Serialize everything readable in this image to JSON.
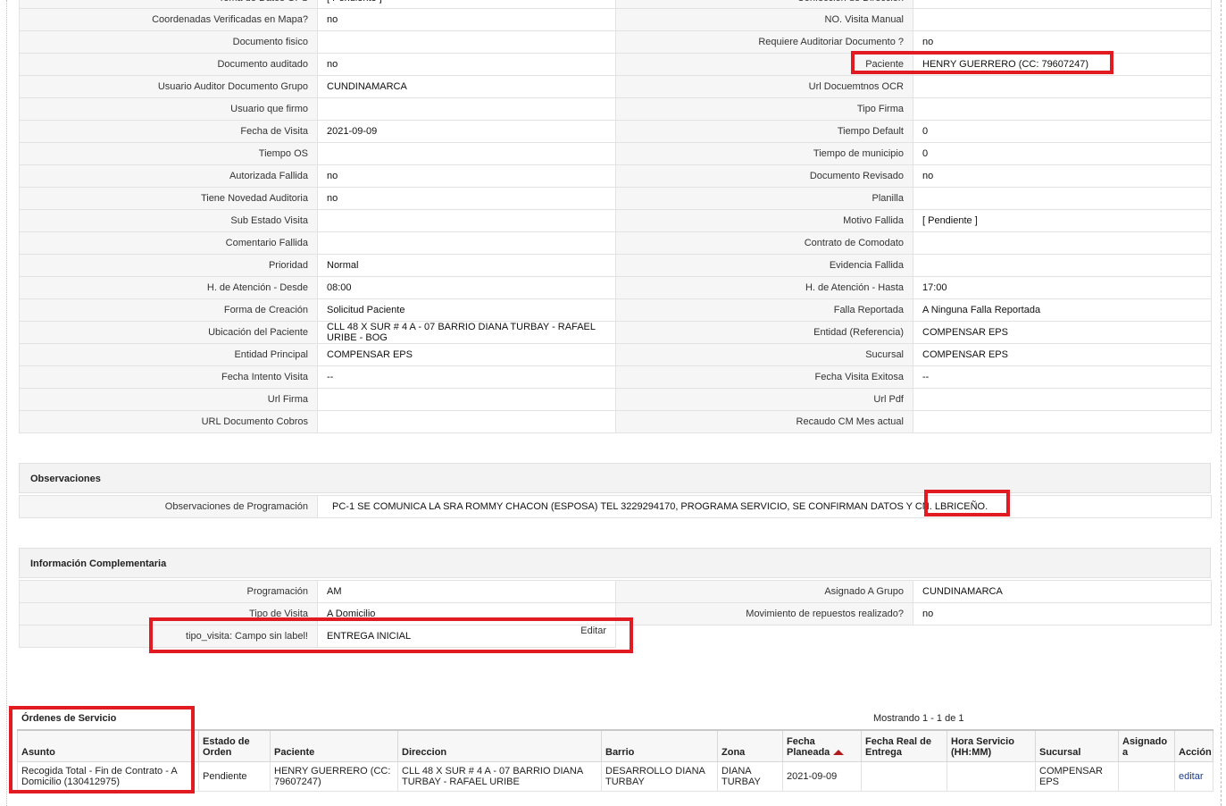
{
  "details": [
    [
      "Coordenadas Verificadas en Mapa?",
      "no",
      "NO. Visita Manual",
      ""
    ],
    [
      "Documento fisico",
      "",
      "Requiere Auditoriar Documento ?",
      "no"
    ],
    [
      "Documento auditado",
      "no",
      "Paciente",
      "HENRY GUERRERO (CC: 79607247)"
    ],
    [
      "Usuario Auditor Documento Grupo",
      "CUNDINAMARCA",
      "Url Docuemtnos OCR",
      ""
    ],
    [
      "Usuario que firmo",
      "",
      "Tipo Firma",
      ""
    ],
    [
      "Fecha de Visita",
      "2021-09-09",
      "Tiempo Default",
      "0"
    ],
    [
      "Tiempo OS",
      "",
      "Tiempo de municipio",
      "0"
    ],
    [
      "Autorizada Fallida",
      "no",
      "Documento Revisado",
      "no"
    ],
    [
      "Tiene Novedad Auditoria",
      "no",
      "Planilla",
      ""
    ],
    [
      "Sub Estado Visita",
      "",
      "Motivo Fallida",
      "[ Pendiente ]"
    ],
    [
      "Comentario Fallida",
      "",
      "Contrato de Comodato",
      ""
    ],
    [
      "Prioridad",
      "Normal",
      "Evidencia Fallida",
      ""
    ],
    [
      "H. de Atención - Desde",
      "08:00",
      "H. de Atención - Hasta",
      "17:00"
    ],
    [
      "Forma de Creación",
      "Solicitud Paciente",
      "Falla Reportada",
      "A Ninguna Falla Reportada"
    ],
    [
      "Ubicación del Paciente",
      "CLL 48 X SUR # 4 A - 07 BARRIO DIANA TURBAY - RAFAEL URIBE - BOG",
      "Entidad (Referencia)",
      "COMPENSAR EPS"
    ],
    [
      "Entidad Principal",
      "COMPENSAR EPS",
      "Sucursal",
      "COMPENSAR EPS"
    ],
    [
      "Fecha Intento Visita",
      "--",
      "Fecha Visita Exitosa",
      "--"
    ],
    [
      "Url Firma",
      "",
      "Url Pdf",
      ""
    ],
    [
      "URL Documento Cobros",
      "",
      "Recaudo CM Mes actual",
      ""
    ]
  ],
  "top_partial": {
    "label_left": "Tema de Datos GPS",
    "value_left": "[ Pendiente ]",
    "label_right": "Confección de Dirección",
    "value_right": ""
  },
  "observaciones": {
    "title": "Observaciones",
    "label": "Observaciones de Programación",
    "value": "PC-1 SE COMUNICA LA SRA ROMMY CHACON (ESPOSA) TEL 3229294170, PROGRAMA SERVICIO, SE CONFIRMAN DATOS Y CN. LBRICEÑO."
  },
  "info": {
    "title": "Información Complementaria",
    "rows": [
      [
        "Programación",
        "AM",
        "Asignado A Grupo",
        "CUNDINAMARCA"
      ],
      [
        "Tipo de Visita",
        "A Domicilio",
        "Movimiento de repuestos realizado?",
        "no"
      ]
    ],
    "tipo_label": "tipo_visita: Campo sin label!",
    "tipo_value": "ENTREGA INICIAL",
    "edit_label": "Editar"
  },
  "orders": {
    "title": "Órdenes de Servicio",
    "count_text": "Mostrando 1 - 1 de 1",
    "headers": [
      "Asunto",
      "Estado de Orden",
      "Paciente",
      "Direccion",
      "Barrio",
      "Zona",
      "Fecha Planeada",
      "Fecha Real de Entrega",
      "Hora Servicio (HH:MM)",
      "Sucursal",
      "Asignado a",
      "Acción"
    ],
    "row": {
      "asunto": "Recogida Total - Fin de Contrato - A Domicilio (130412975)",
      "estado": "Pendiente",
      "paciente": "HENRY GUERRERO (CC: 79607247)",
      "direccion": "CLL 48 X SUR # 4 A - 07 BARRIO DIANA TURBAY - RAFAEL URIBE",
      "barrio": "DESARROLLO DIANA TURBAY",
      "zona": "DIANA TURBAY",
      "fecha_planeada": "2021-09-09",
      "fecha_real": "",
      "hora": "",
      "sucursal": "COMPENSAR EPS",
      "asignado": "",
      "accion": "editar"
    }
  },
  "colors": {
    "highlight": "#e21b23",
    "link": "#1a3c8c",
    "label_bg": "#f6f6f6"
  }
}
